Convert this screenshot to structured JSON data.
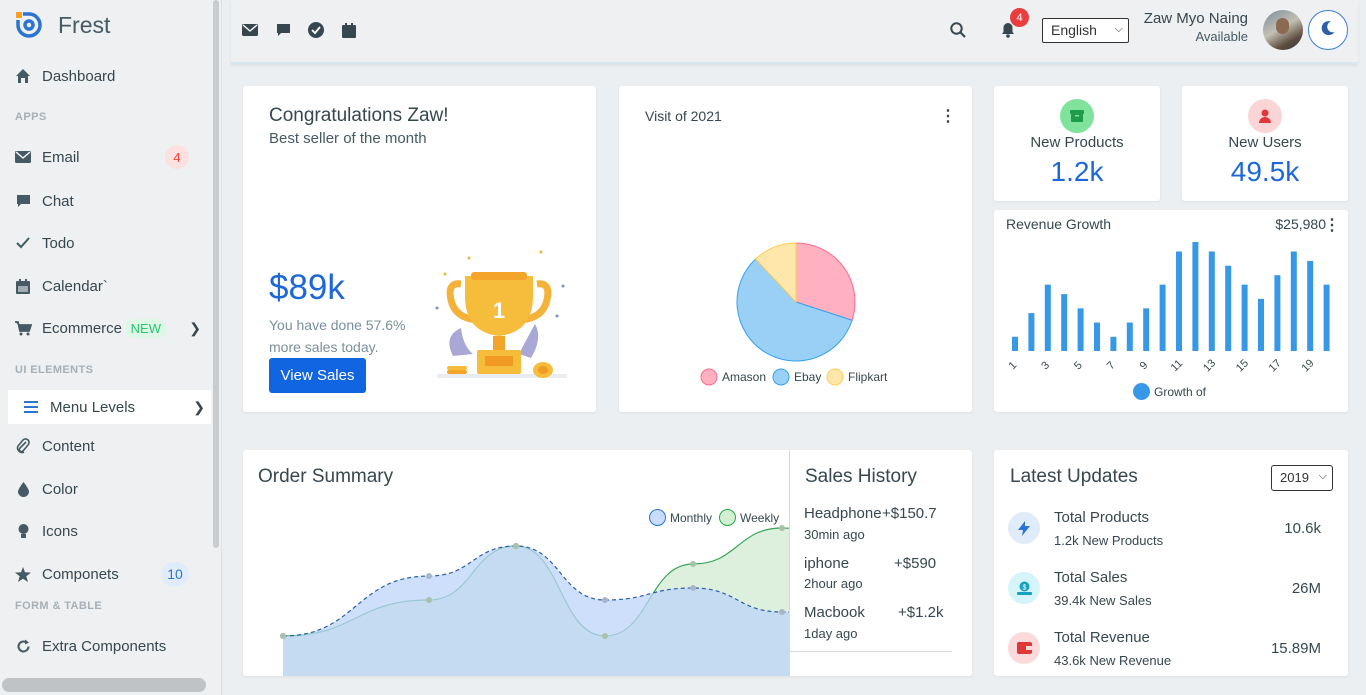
{
  "brand": {
    "name": "Frest"
  },
  "sidebar": {
    "dashboard": "Dashboard",
    "section_apps": "APPS",
    "email": "Email",
    "email_badge": "4",
    "chat": "Chat",
    "todo": "Todo",
    "calendar": "Calendar`",
    "ecommerce": "Ecommerce",
    "ecommerce_badge": "NEW",
    "section_ui": "UI ELEMENTS",
    "menu_levels": "Menu Levels",
    "content": "Content",
    "color": "Color",
    "icons": "Icons",
    "componets": "Componets",
    "componets_badge": "10",
    "section_form": "FORM & TABLE",
    "extra": "Extra Components"
  },
  "topbar": {
    "notification_count": "4",
    "language": "English",
    "user_name": "Zaw Myo Naing",
    "user_status": "Available"
  },
  "congrats": {
    "title": "Congratulations Zaw!",
    "subtitle": "Best seller of the month",
    "amount": "$89k",
    "note": "You have done 57.6% more sales today.",
    "button": "View Sales",
    "trophy_number": "1"
  },
  "visits": {
    "title": "Visit of 2021"
  },
  "new_products": {
    "label": "New Products",
    "value": "1.2k"
  },
  "new_users": {
    "label": "New Users",
    "value": "49.5k"
  },
  "revenue": {
    "title": "Revenue Growth",
    "total": "$25,980",
    "legend": "Growth of"
  },
  "order_summary": {
    "title": "Order Summary",
    "legend_monthly": "Monthly",
    "legend_weekly": "Weekly"
  },
  "sales_history": {
    "title": "Sales History",
    "items": [
      {
        "name": "Headphone",
        "amount": "+$150.7",
        "time": "30min ago"
      },
      {
        "name": "iphone",
        "amount": "+$590",
        "time": "2hour ago"
      },
      {
        "name": "Macbook",
        "amount": "+$1.2k",
        "time": "1day ago"
      }
    ]
  },
  "latest_updates": {
    "title": "Latest Updates",
    "year": "2019",
    "items": [
      {
        "title": "Total Products",
        "count": "1.2k",
        "unit": "New Products",
        "value": "10.6k"
      },
      {
        "title": "Total Sales",
        "count": "39.4k",
        "unit": "New Sales",
        "value": "26M"
      },
      {
        "title": "Total Revenue",
        "count": "43.6k",
        "unit": "New Revenue",
        "value": "15.89M"
      }
    ]
  },
  "colors": {
    "primary": "#1d68d8",
    "danger": "#ea3d3d",
    "success": "#28c76f"
  },
  "chart_data": [
    {
      "type": "pie",
      "title": "Visit of 2021",
      "categories": [
        "Amason",
        "Ebay",
        "Flipkart"
      ],
      "values": [
        30,
        58,
        12
      ],
      "colors": [
        "#ffb1c1",
        "#9ad0f5",
        "#ffe6aa"
      ],
      "legend": "bottom"
    },
    {
      "type": "bar",
      "title": "Revenue Growth",
      "categories": [
        "1",
        "2",
        "3",
        "4",
        "5",
        "6",
        "7",
        "8",
        "9",
        "10",
        "11",
        "12",
        "13",
        "14",
        "15",
        "16",
        "17",
        "18",
        "19",
        "20"
      ],
      "tick_labels": [
        "1",
        "3",
        "5",
        "7",
        "9",
        "11",
        "13",
        "15",
        "17",
        "19"
      ],
      "series": [
        {
          "name": "Growth of",
          "values": [
            3,
            8,
            14,
            12,
            9,
            6,
            3,
            6,
            9,
            14,
            21,
            23,
            21,
            18,
            14,
            11,
            16,
            21,
            19,
            14
          ]
        }
      ],
      "ylim": [
        0,
        23
      ],
      "color": "#3898e8",
      "legend": "bottom"
    },
    {
      "type": "area",
      "title": "Order Summary",
      "x": [
        0,
        1,
        2,
        3,
        4,
        5,
        6
      ],
      "series": [
        {
          "name": "Monthly",
          "values": [
            0,
            10,
            15,
            6,
            8,
            4,
            3
          ],
          "color": "#9bbff5"
        },
        {
          "name": "Weekly",
          "values": [
            0,
            6,
            15,
            0,
            12,
            18,
            8
          ],
          "color": "#a8d8a8"
        }
      ],
      "legend": "top-right"
    }
  ]
}
